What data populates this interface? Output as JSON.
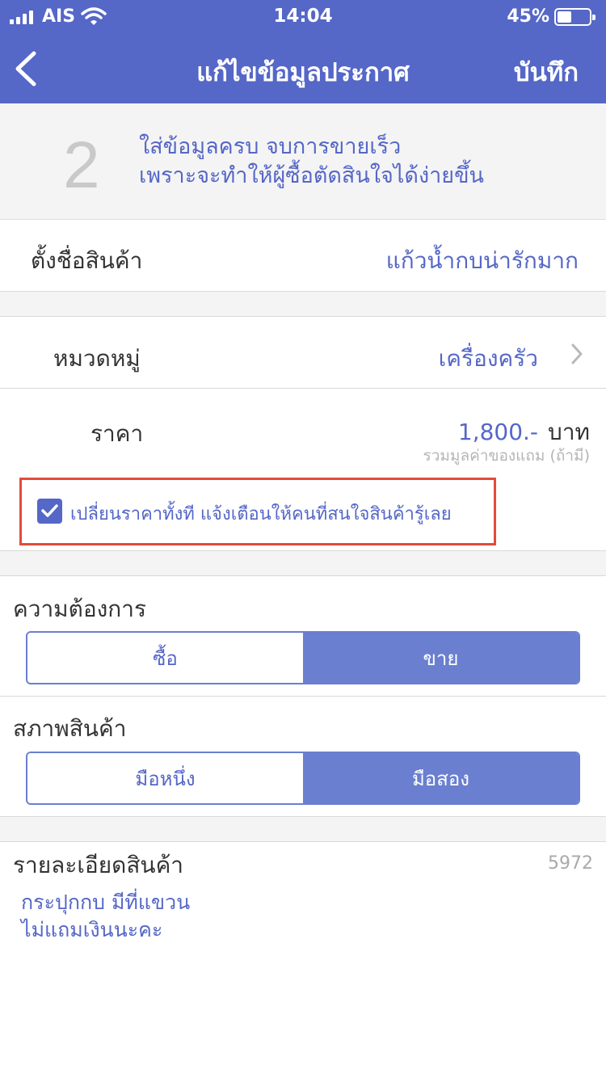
{
  "status_bar": {
    "carrier": "AIS",
    "time": "14:04",
    "battery": "45%",
    "battery_level": 0.45
  },
  "nav": {
    "title": "แก้ไขข้อมูลประกาศ",
    "save_label": "บันทึก"
  },
  "banner": {
    "step": "2",
    "line1": "ใส่ข้อมูลครบ จบการขายเร็ว",
    "line2": "เพราะจะทำให้ผู้ซื้อตัดสินใจได้ง่ายขึ้น"
  },
  "product_name": {
    "label": "ตั้งชื่อสินค้า",
    "value": "แก้วน้ำกบน่ารักมาก"
  },
  "category": {
    "label": "หมวดหมู่",
    "value": "เครื่องครัว"
  },
  "price": {
    "label": "ราคา",
    "value": "1,800.-",
    "unit": "บาท",
    "note": "รวมมูลค่าของแถม (ถ้ามี)"
  },
  "notify": {
    "checked": true,
    "label": "เปลี่ยนราคาทั้งที แจ้งเตือนให้คนที่สนใจสินค้ารู้เลย"
  },
  "intent": {
    "label": "ความต้องการ",
    "options": [
      "ซื้อ",
      "ขาย"
    ],
    "selected": "ขาย"
  },
  "condition": {
    "label": "สภาพสินค้า",
    "options": [
      "มือหนึ่ง",
      "มือสอง"
    ],
    "selected": "มือสอง"
  },
  "description": {
    "label": "รายละเอียดสินค้า",
    "remaining": "5972",
    "text": "กระปุกกบ มีที่แขวน\nไม่แถมเงินนะคะ"
  },
  "colors": {
    "primary": "#5567c7",
    "segment_active": "#6a7fd0",
    "highlight_border": "#e44a3a"
  }
}
